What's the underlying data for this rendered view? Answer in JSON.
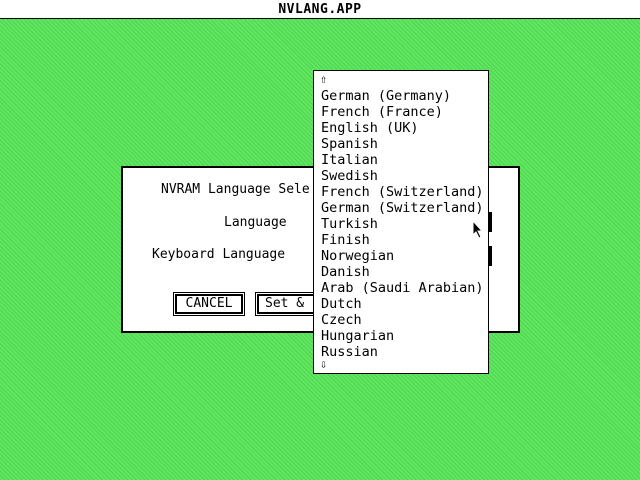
{
  "window": {
    "title": "NVLANG.APP"
  },
  "dialog": {
    "title": "NVRAM Language Sele",
    "language_label": "Language",
    "keyboard_label": "Keyboard Language",
    "cancel_label": "CANCEL",
    "set_label": "Set &"
  },
  "popup": {
    "scroll_up_icon": "arrow-up-icon",
    "scroll_down_icon": "arrow-down-icon",
    "items": [
      "German (Germany)",
      "French (France)",
      "English (UK)",
      "Spanish",
      "Italian",
      "Swedish",
      "French (Switzerland)",
      "German (Switzerland)",
      "Turkish",
      "Finish",
      "Norwegian",
      "Danish",
      "Arab (Saudi Arabian)",
      "Dutch",
      "Czech",
      "Hungarian",
      "Russian"
    ]
  },
  "colors": {
    "desktop": "#5ee85e",
    "window": "#ffffff",
    "ink": "#000000"
  }
}
